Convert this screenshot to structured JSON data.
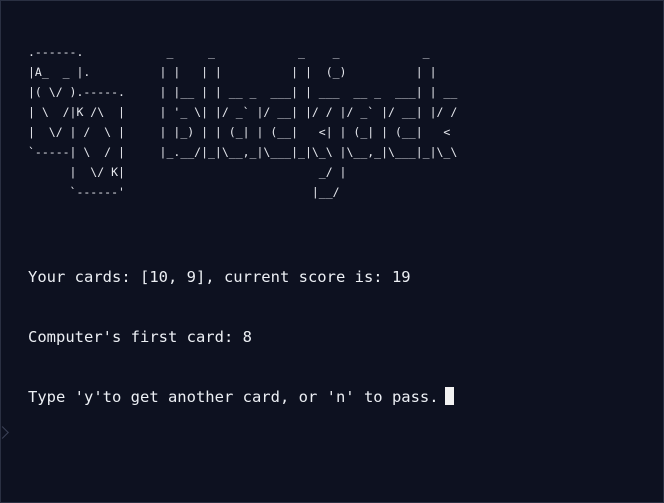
{
  "logo": {
    "lines": [
      ".------.            _     _            _    _            _    ",
      "|A_  _ |.          | |   | |          | |  (_)          | |   ",
      "|( \\/ ).-----.     | |__ | | __ _  ___| | ___  __ _  ___| | __",
      "| \\  /|K /\\  |     | '_ \\| |/ _` |/ __| |/ / |/ _` |/ __| |/ /",
      "|  \\/ | /  \\ |     | |_) | | (_| | (__|   <| | (_| | (__|   < ",
      "`-----| \\  / |     |_.__/|_|\\__,_|\\___|_|\\_\\ |\\__,_|\\___|_|\\_\\",
      "      |  \\/ K|                            _/ |                ",
      "      `------'                           |__/                 "
    ]
  },
  "output": {
    "line1": "Your cards: [10, 9], current score is: 19",
    "line2": "Computer's first card: 8",
    "line3": "Type 'y'to get another card, or 'n' to pass."
  }
}
